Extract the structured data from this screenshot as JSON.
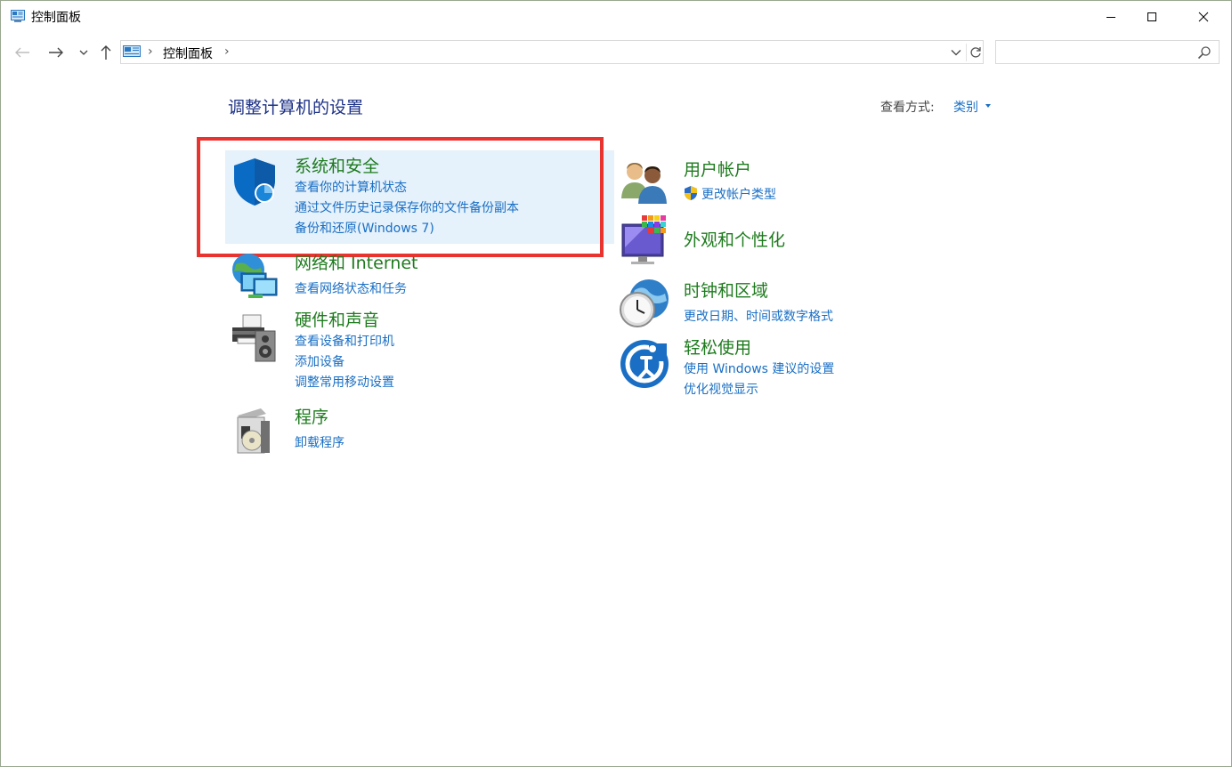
{
  "window": {
    "title": "控制面板"
  },
  "address": {
    "crumb": "控制面板",
    "search_placeholder": ""
  },
  "page": {
    "title": "调整计算机的设置",
    "view_label": "查看方式:",
    "view_value": "类别"
  },
  "categories": {
    "system": {
      "title": "系统和安全",
      "links": [
        "查看你的计算机状态",
        "通过文件历史记录保存你的文件备份副本",
        "备份和还原(Windows 7)"
      ]
    },
    "network": {
      "title": "网络和 Internet",
      "links": [
        "查看网络状态和任务"
      ]
    },
    "hardware": {
      "title": "硬件和声音",
      "links": [
        "查看设备和打印机",
        "添加设备",
        "调整常用移动设置"
      ]
    },
    "programs": {
      "title": "程序",
      "links": [
        "卸载程序"
      ]
    },
    "users": {
      "title": "用户帐户",
      "links": [
        "更改帐户类型"
      ]
    },
    "appearance": {
      "title": "外观和个性化",
      "links": []
    },
    "clock": {
      "title": "时钟和区域",
      "links": [
        "更改日期、时间或数字格式"
      ]
    },
    "ease": {
      "title": "轻松使用",
      "links": [
        "使用 Windows 建议的设置",
        "优化视觉显示"
      ]
    }
  },
  "colors": {
    "category_title": "#1e7b1e",
    "link": "#1a6fc4",
    "page_title": "#1e3287",
    "highlight": "#e5f1fb",
    "annotation": "#e8332f"
  },
  "icons": {
    "app": "control-panel-icon",
    "back": "arrow-left-icon",
    "forward": "arrow-right-icon",
    "recent": "chevron-down-icon",
    "up": "arrow-up-icon",
    "refresh": "refresh-icon",
    "search": "search-icon",
    "system": "shield-icon",
    "network": "network-monitors-icon",
    "hardware": "printer-speaker-icon",
    "programs": "program-box-icon",
    "users": "users-icon",
    "appearance": "monitor-colors-icon",
    "clock": "globe-clock-icon",
    "ease": "ease-of-access-icon",
    "uac": "uac-shield-icon"
  }
}
